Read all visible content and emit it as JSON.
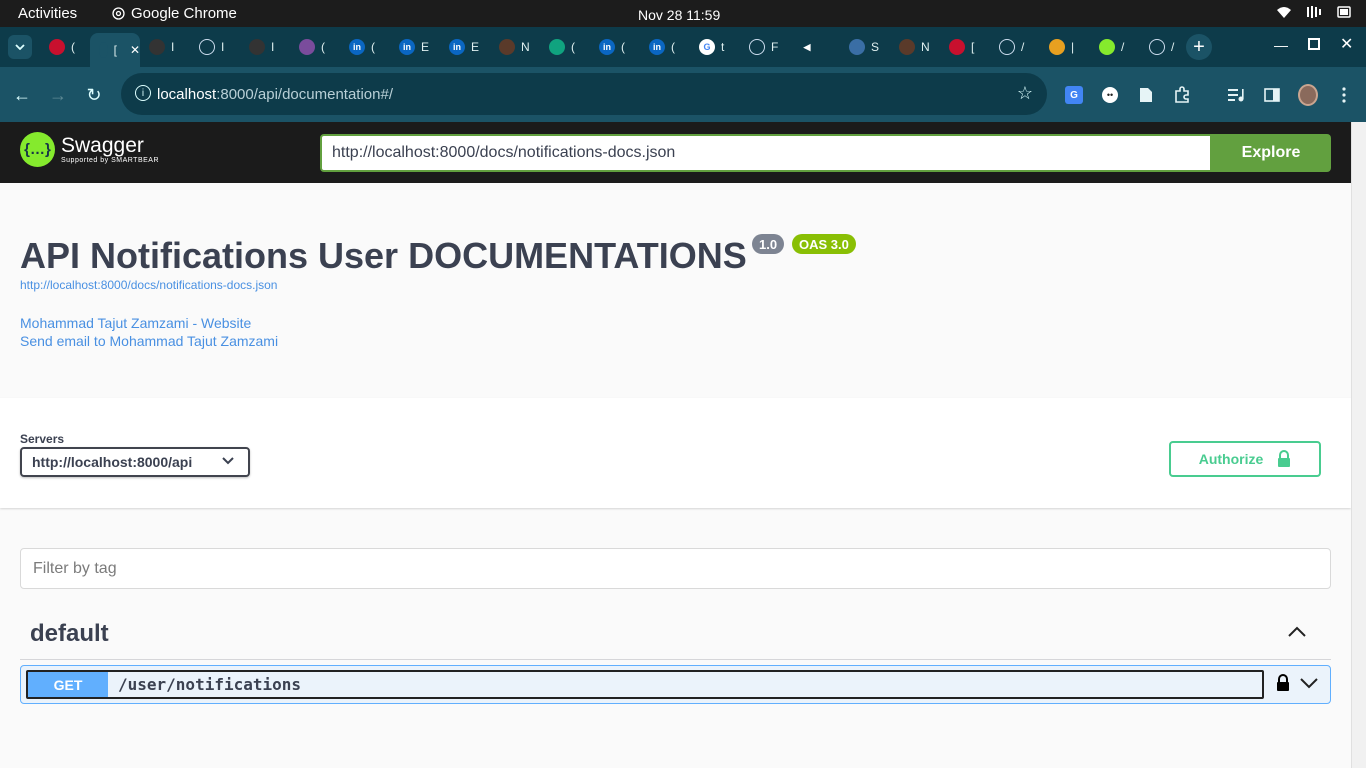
{
  "os": {
    "activities": "Activities",
    "app_name": "Google Chrome",
    "clock": "Nov 28  11:59"
  },
  "browser": {
    "tabs": [
      {
        "icon": "pinterest-icon",
        "text": "("
      },
      {
        "icon": "blank-icon",
        "text": "[",
        "active": true
      },
      {
        "icon": "github-icon",
        "text": "I"
      },
      {
        "icon": "loading-icon",
        "text": "I"
      },
      {
        "icon": "github-icon",
        "text": "I"
      },
      {
        "icon": "app-icon",
        "text": "("
      },
      {
        "icon": "linkedin-icon",
        "text": "("
      },
      {
        "icon": "linkedin-icon",
        "text": "E"
      },
      {
        "icon": "linkedin-icon",
        "text": "E"
      },
      {
        "icon": "folder-icon",
        "text": "N"
      },
      {
        "icon": "chatgpt-icon",
        "text": "("
      },
      {
        "icon": "linkedin-icon",
        "text": "("
      },
      {
        "icon": "linkedin-icon",
        "text": "("
      },
      {
        "icon": "google-icon",
        "text": "t"
      },
      {
        "icon": "loading-icon",
        "text": "F"
      },
      {
        "icon": "speaker-icon",
        "text": ""
      },
      {
        "icon": "globe-icon",
        "text": "S"
      },
      {
        "icon": "folder-icon",
        "text": "N"
      },
      {
        "icon": "pinterest-icon",
        "text": "["
      },
      {
        "icon": "link-icon",
        "text": "/"
      },
      {
        "icon": "sail-icon",
        "text": "|"
      },
      {
        "icon": "swagger-icon",
        "text": "/"
      },
      {
        "icon": "link-icon",
        "text": "/"
      }
    ],
    "url_host": "localhost",
    "url_path": ":8000/api/documentation#/"
  },
  "swagger": {
    "logo_name": "Swagger",
    "logo_sub": "Supported by SMARTBEAR",
    "spec_url_value": "http://localhost:8000/docs/notifications-docs.json",
    "explore_label": "Explore",
    "title": "API Notifications User DOCUMENTATIONS",
    "version_badge": "1.0",
    "oas_badge": "OAS 3.0",
    "spec_link": "http://localhost:8000/docs/notifications-docs.json",
    "contact_website": "Mohammad Tajut Zamzami - Website",
    "contact_email": "Send email to Mohammad Tajut Zamzami",
    "servers_label": "Servers",
    "server_selected": "http://localhost:8000/api",
    "authorize_label": "Authorize",
    "filter_placeholder": "Filter by tag",
    "tag_name": "default",
    "operations": [
      {
        "method": "GET",
        "path": "/user/notifications"
      }
    ]
  },
  "colors": {
    "swagger_green": "#62a03f",
    "get_blue": "#61affe",
    "authorize_green": "#49cc90",
    "tab_bg": "#0d3b4a",
    "toolbar_bg": "#1b5366"
  }
}
